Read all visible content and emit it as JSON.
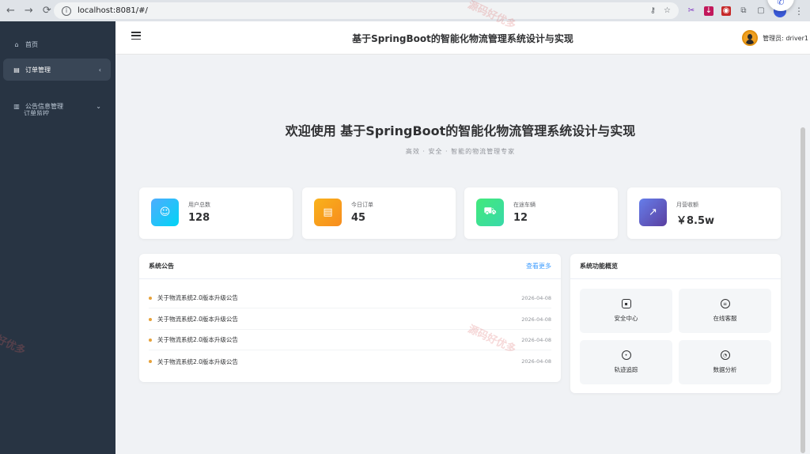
{
  "browser": {
    "url": "localhost:8081/#/",
    "back_icon": "arrow-left-icon",
    "forward_icon": "arrow-right-icon",
    "reload_icon": "reload-icon"
  },
  "sidebar": {
    "items": [
      {
        "label": "首页",
        "icon": "home-icon"
      },
      {
        "label": "订单管理",
        "icon": "document-icon"
      },
      {
        "label": "公告信息管理",
        "icon": "book-icon"
      }
    ],
    "sub_cut": "订单监控"
  },
  "header": {
    "title": "基于SpringBoot的智能化物流管理系统设计与实现",
    "user_label": "管理员: driver1"
  },
  "main": {
    "welcome": "欢迎使用 基于SpringBoot的智能化物流管理系统设计与实现",
    "subtitle": "高效 · 安全 · 智能的物流管理专家",
    "stats": [
      {
        "label": "用户总数",
        "value": "128",
        "icon": "user-icon",
        "color": "#3ec7f5"
      },
      {
        "label": "今日订单",
        "value": "45",
        "icon": "clipboard-icon",
        "color": "#f5a623"
      },
      {
        "label": "在途车辆",
        "value": "12",
        "icon": "truck-icon",
        "color": "#3ddc97"
      },
      {
        "label": "月营收额",
        "value": "￥8.5w",
        "icon": "chart-icon",
        "color": "#6a5acd"
      }
    ],
    "notice": {
      "title": "系统公告",
      "more": "查看更多",
      "items": [
        {
          "title": "关于物流系统2.0版本升级公告",
          "date": "2026-04-08"
        },
        {
          "title": "关于物流系统2.0版本升级公告",
          "date": "2026-04-08"
        },
        {
          "title": "关于物流系统2.0版本升级公告",
          "date": "2026-04-08"
        },
        {
          "title": "关于物流系统2.0版本升级公告",
          "date": "2026-04-08"
        }
      ]
    },
    "overview": {
      "title": "系统功能概览",
      "items": [
        {
          "label": "安全中心",
          "icon": "lock-icon"
        },
        {
          "label": "在线客服",
          "icon": "chat-icon"
        },
        {
          "label": "轨迹追踪",
          "icon": "location-icon"
        },
        {
          "label": "数据分析",
          "icon": "pie-chart-icon"
        }
      ]
    }
  },
  "watermark": "源码好优多"
}
